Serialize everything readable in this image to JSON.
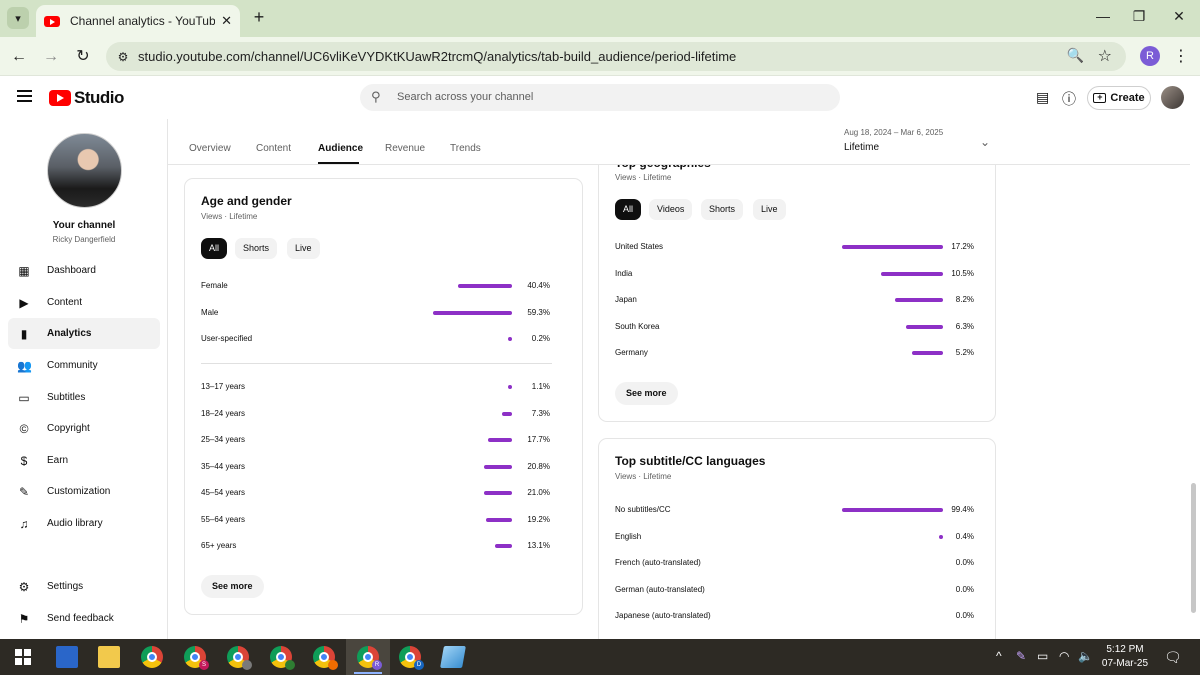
{
  "browser": {
    "tab_title": "Channel analytics - YouTube Studio",
    "url": "studio.youtube.com/channel/UC6vliKeVYDKtKUawR2trcmQ/analytics/tab-build_audience/period-lifetime",
    "profile_initial": "R"
  },
  "header": {
    "logo_text": "Studio",
    "search_placeholder": "Search across your channel",
    "create_label": "Create"
  },
  "sidebar": {
    "your_channel": "Your channel",
    "channel_name": "Ricky Dangerfield",
    "items": [
      {
        "label": "Dashboard",
        "icon": "dashboard-icon"
      },
      {
        "label": "Content",
        "icon": "content-icon"
      },
      {
        "label": "Analytics",
        "icon": "analytics-icon",
        "active": true
      },
      {
        "label": "Community",
        "icon": "community-icon"
      },
      {
        "label": "Subtitles",
        "icon": "subtitles-icon"
      },
      {
        "label": "Copyright",
        "icon": "copyright-icon"
      },
      {
        "label": "Earn",
        "icon": "earn-icon"
      },
      {
        "label": "Customization",
        "icon": "customization-icon"
      },
      {
        "label": "Audio library",
        "icon": "audio-library-icon"
      }
    ],
    "bottom_items": [
      {
        "label": "Settings",
        "icon": "settings-icon"
      },
      {
        "label": "Send feedback",
        "icon": "feedback-icon"
      }
    ]
  },
  "analytics_tabs": [
    {
      "label": "Overview"
    },
    {
      "label": "Content"
    },
    {
      "label": "Audience",
      "active": true
    },
    {
      "label": "Revenue"
    },
    {
      "label": "Trends"
    }
  ],
  "period": {
    "range": "Aug 18, 2024 – Mar 6, 2025",
    "value": "Lifetime"
  },
  "age_gender": {
    "title": "Age and gender",
    "subtitle": "Views · Lifetime",
    "filters": [
      "All",
      "Shorts",
      "Live"
    ],
    "gender": [
      {
        "label": "Female",
        "value": 40.4,
        "display": "40.4%"
      },
      {
        "label": "Male",
        "value": 59.3,
        "display": "59.3%"
      },
      {
        "label": "User-specified",
        "value": 0.2,
        "display": "0.2%"
      }
    ],
    "age": [
      {
        "label": "13–17 years",
        "value": 1.1,
        "display": "1.1%"
      },
      {
        "label": "18–24 years",
        "value": 7.3,
        "display": "7.3%"
      },
      {
        "label": "25–34 years",
        "value": 17.7,
        "display": "17.7%"
      },
      {
        "label": "35–44 years",
        "value": 20.8,
        "display": "20.8%"
      },
      {
        "label": "45–54 years",
        "value": 21.0,
        "display": "21.0%"
      },
      {
        "label": "55–64 years",
        "value": 19.2,
        "display": "19.2%"
      },
      {
        "label": "65+ years",
        "value": 13.1,
        "display": "13.1%"
      }
    ],
    "see_more": "See more"
  },
  "geographies": {
    "title": "Top geographies",
    "subtitle": "Views · Lifetime",
    "filters": [
      "All",
      "Videos",
      "Shorts",
      "Live"
    ],
    "rows": [
      {
        "label": "United States",
        "value": 17.2,
        "display": "17.2%"
      },
      {
        "label": "India",
        "value": 10.5,
        "display": "10.5%"
      },
      {
        "label": "Japan",
        "value": 8.2,
        "display": "8.2%"
      },
      {
        "label": "South Korea",
        "value": 6.3,
        "display": "6.3%"
      },
      {
        "label": "Germany",
        "value": 5.2,
        "display": "5.2%"
      }
    ],
    "see_more": "See more"
  },
  "subtitles_card": {
    "title": "Top subtitle/CC languages",
    "subtitle": "Views · Lifetime",
    "rows": [
      {
        "label": "No subtitles/CC",
        "value": 99.4,
        "display": "99.4%"
      },
      {
        "label": "English",
        "value": 0.4,
        "display": "0.4%"
      },
      {
        "label": "French (auto-translated)",
        "value": 0.0,
        "display": "0.0%"
      },
      {
        "label": "German (auto-translated)",
        "value": 0.0,
        "display": "0.0%"
      },
      {
        "label": "Japanese (auto-translated)",
        "value": 0.0,
        "display": "0.0%"
      }
    ]
  },
  "taskbar": {
    "time": "5:12 PM",
    "date": "07-Mar-25"
  },
  "colors": {
    "bar": "#8d30c6",
    "browser_frame": "#d3e3c7",
    "youtube_red": "#ff0000"
  }
}
